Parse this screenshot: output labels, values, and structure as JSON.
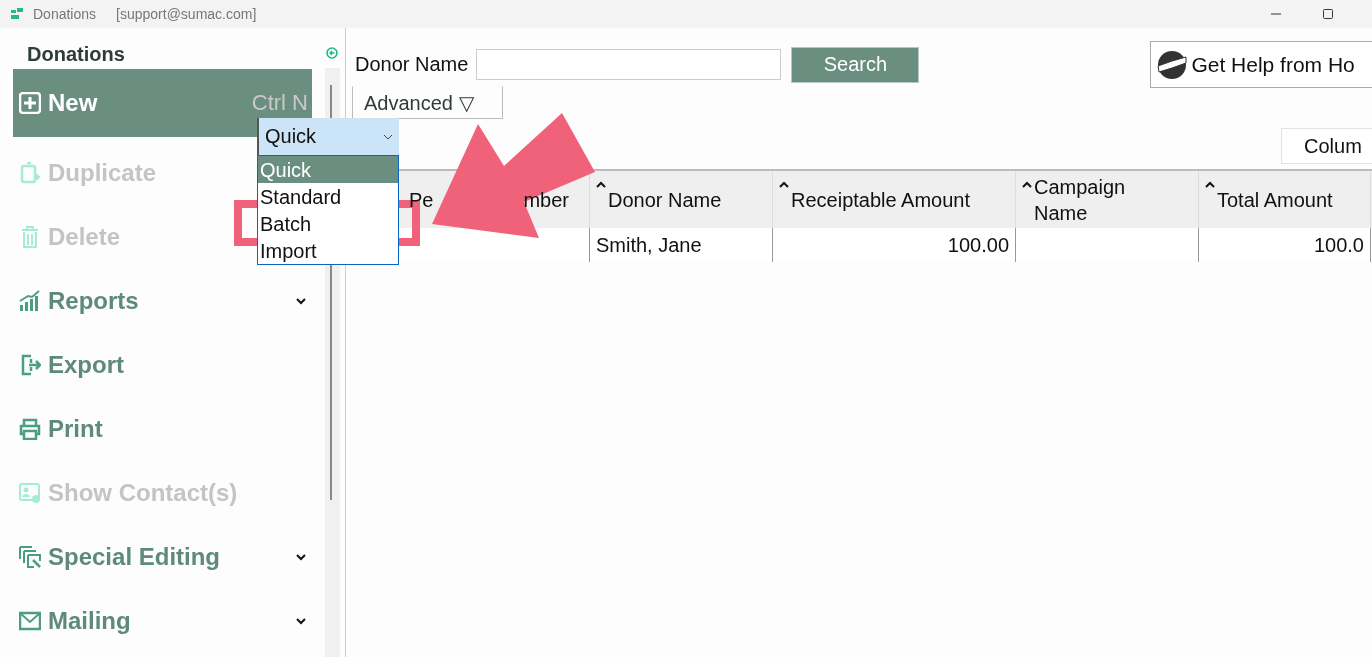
{
  "window": {
    "title": "Donations",
    "account": "[support@sumac.com]"
  },
  "sidebar": {
    "title": "Donations",
    "items": [
      {
        "label": "New",
        "shortcut": "Ctrl N",
        "selected": true,
        "disabled": false,
        "submenu": false
      },
      {
        "label": "Duplicate",
        "selected": false,
        "disabled": true,
        "submenu": false
      },
      {
        "label": "Delete",
        "selected": false,
        "disabled": true,
        "submenu": false
      },
      {
        "label": "Reports",
        "selected": false,
        "disabled": false,
        "submenu": true
      },
      {
        "label": "Export",
        "selected": false,
        "disabled": false,
        "submenu": false
      },
      {
        "label": "Print",
        "selected": false,
        "disabled": false,
        "submenu": false
      },
      {
        "label": "Show Contact(s)",
        "selected": false,
        "disabled": true,
        "submenu": false
      },
      {
        "label": "Special Editing",
        "selected": false,
        "disabled": false,
        "submenu": true
      },
      {
        "label": "Mailing",
        "selected": false,
        "disabled": false,
        "submenu": true
      }
    ]
  },
  "new_type_dropdown": {
    "value": "Quick",
    "expanded": true,
    "options": [
      {
        "label": "Quick",
        "selected": true
      },
      {
        "label": "Standard",
        "selected": false
      },
      {
        "label": "Batch",
        "selected": false
      },
      {
        "label": "Import",
        "selected": false
      }
    ]
  },
  "search": {
    "label": "Donor Name",
    "button": "Search",
    "advanced": "Advanced ▽"
  },
  "help_button": "Get Help from Ho",
  "columns_button": "Colum",
  "table": {
    "columns": [
      {
        "parts": [
          "Pe",
          "mber"
        ],
        "sortable": false
      },
      {
        "parts": [
          "Donor Name"
        ],
        "sortable": true
      },
      {
        "parts": [
          "Receiptable Amount"
        ],
        "sortable": true
      },
      {
        "parts": [
          "Campaign Name"
        ],
        "sortable": true
      },
      {
        "parts": [
          "Total Amount"
        ],
        "sortable": true
      }
    ],
    "rows": [
      [
        "",
        "Smith, Jane",
        "100.00",
        "",
        "100.0"
      ]
    ]
  },
  "annotations": {
    "highlight_frame": true,
    "arrow": true
  }
}
